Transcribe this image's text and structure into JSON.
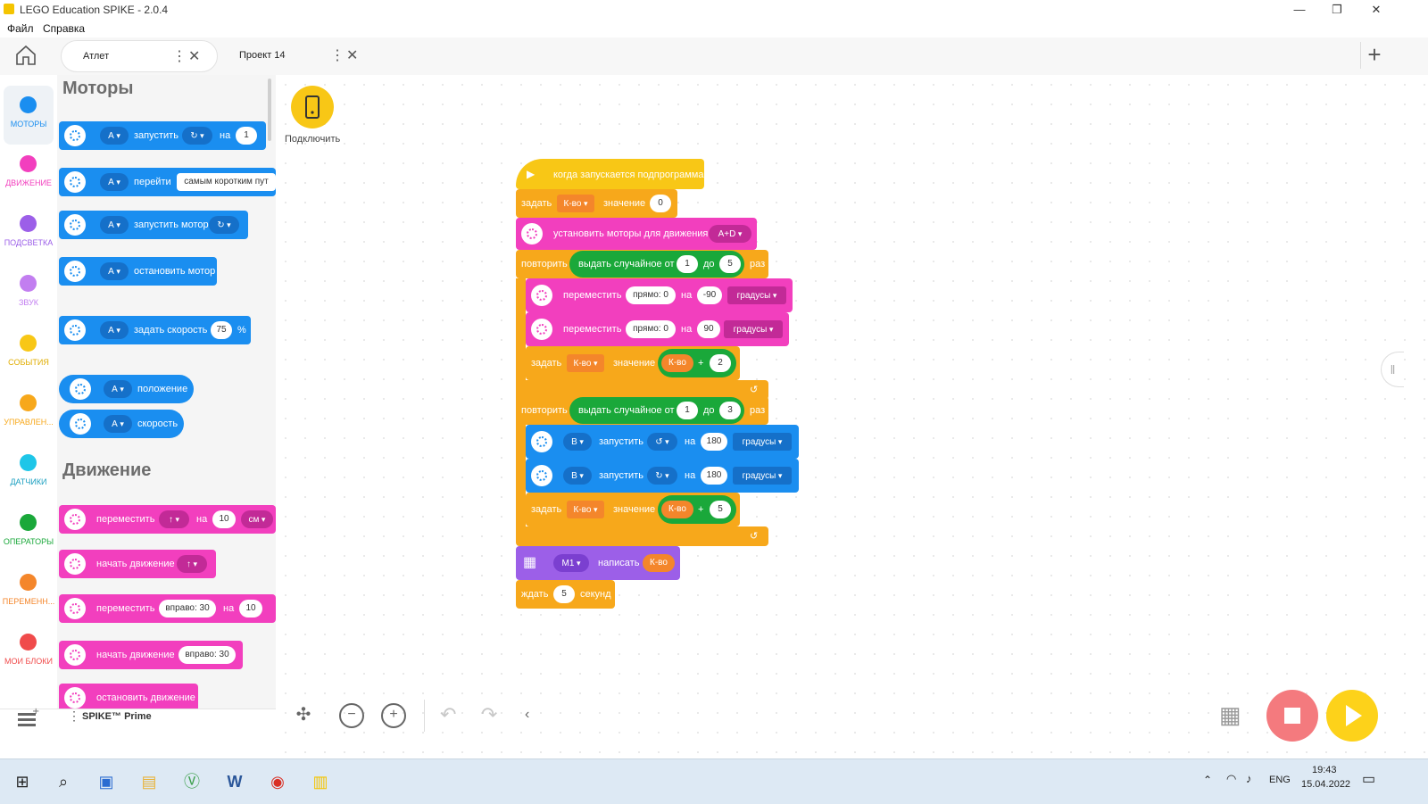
{
  "app": {
    "title": "LEGO Education SPIKE - 2.0.4",
    "min": "—",
    "max": "❐",
    "close": "✕"
  },
  "menu": [
    "Файл",
    "Справка"
  ],
  "tabs": [
    {
      "label": "Атлет"
    },
    {
      "label": "Проект 14"
    }
  ],
  "categories": [
    {
      "name": "МОТОРЫ",
      "color": "#1a8ef0"
    },
    {
      "name": "ДВИЖЕНИЕ",
      "color": "#f23fbe"
    },
    {
      "name": "ПОДСВЕТКА",
      "color": "#9c5fe8"
    },
    {
      "name": "ЗВУК",
      "color": "#c27ef0"
    },
    {
      "name": "СОБЫТИЯ",
      "color": "#f8c716"
    },
    {
      "name": "УПРАВЛЕН...",
      "color": "#f7a81b"
    },
    {
      "name": "ДАТЧИКИ",
      "color": "#1ec6e8"
    },
    {
      "name": "ОПЕРАТОРЫ",
      "color": "#1aa83a"
    },
    {
      "name": "ПЕРЕМЕНН...",
      "color": "#f4862b"
    },
    {
      "name": "МОИ БЛОКИ",
      "color": "#f04b4b"
    }
  ],
  "palette": {
    "motors_header": "Моторы",
    "movement_header": "Движение",
    "port_a": "A",
    "run": "запустить",
    "on": "на",
    "one": "1",
    "go_to": "перейти",
    "shortest": "самым коротким пут",
    "run_motor": "запустить мотор",
    "stop_motor": "остановить мотор",
    "set_speed": "задать скорость",
    "speed_val": "75",
    "pct": "%",
    "position": "положение",
    "speed": "скорость",
    "move": "переместить",
    "ten": "10",
    "cm": "см",
    "start_move": "начать движение",
    "right30": "вправо: 30",
    "stop_move": "остановить движение"
  },
  "bottom_left": {
    "hub": "SPIKE™ Prime"
  },
  "connect": {
    "label": "Подключить"
  },
  "program": {
    "when_starts": "когда запускается подпрограмма",
    "set": "задать",
    "var": "К-во",
    "value": "значение",
    "zero": "0",
    "set_motors": "установить моторы для движения",
    "motors_pair": "A+D",
    "repeat": "повторить",
    "random": "выдать случайное от",
    "to": "до",
    "times": "раз",
    "r1_from": "1",
    "r1_to": "5",
    "move": "переместить",
    "straight": "прямо: 0",
    "on": "на",
    "deg_a": "-90",
    "deg_b": "90",
    "degrees": "градусы",
    "plus": "+",
    "add1": "2",
    "r2_from": "1",
    "r2_to": "3",
    "port_b": "B",
    "run": "запустить",
    "d180": "180",
    "add2": "5",
    "m1": "M1",
    "write": "написать",
    "wait": "ждать",
    "wait_val": "5",
    "seconds": "секунд"
  },
  "taskbar": {
    "lang": "ENG",
    "time": "19:43",
    "date": "15.04.2022"
  }
}
